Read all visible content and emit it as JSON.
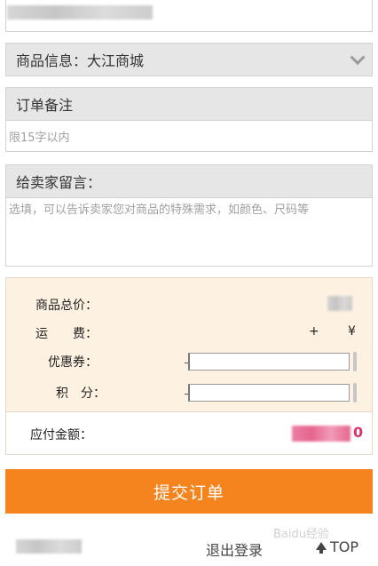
{
  "shop_section": {
    "title": "商品信息：大江商城"
  },
  "order_note": {
    "title": "订单备注",
    "placeholder": "限15字以内"
  },
  "seller_message": {
    "title": "给卖家留言：",
    "placeholder": "选填，可以告诉卖家您对商品的特殊需求，如颜色、尺码等"
  },
  "summary": {
    "total_label": "商品总价：",
    "shipping_label": "运　　费：",
    "shipping_plus": "+",
    "shipping_currency": "¥",
    "coupon_label": "优惠券：",
    "points_label": "积　分：",
    "payable_label": "应付金额：",
    "payable_tail": "0"
  },
  "submit_button": {
    "label": "提交订单"
  },
  "footer": {
    "logout": "退出登录",
    "top": "TOP"
  },
  "watermark": {
    "text": "Baidu经验"
  },
  "colors": {
    "accent": "#f5841f",
    "summary_bg": "#fdf1e2",
    "header_bg": "#e6e6e6",
    "payable_red": "#e0306a"
  }
}
